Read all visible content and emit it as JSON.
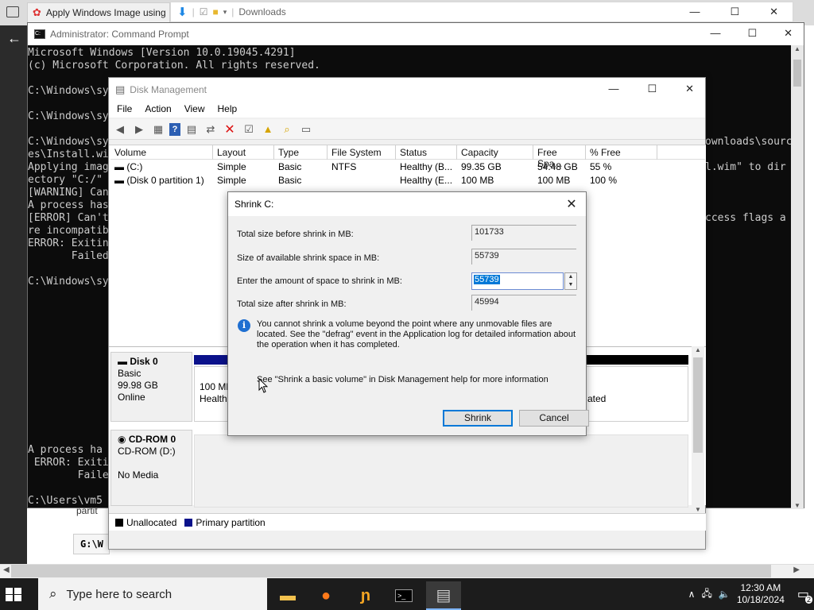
{
  "browser": {
    "tab_title": "Apply Windows Image using",
    "explorer_title": "Downloads"
  },
  "cmd": {
    "title": "Administrator: Command Prompt",
    "lines": [
      "Microsoft Windows [Version 10.0.19045.4291]",
      "(c) Microsoft Corporation. All rights reserved.",
      "",
      "C:\\Windows\\sy",
      "",
      "C:\\Windows\\sy",
      "",
      "C:\\Windows\\sy",
      "es\\Install.wi",
      "Applying imag",
      "ectory \"C:/\"",
      "[WARNING] Can",
      "A process has",
      "[ERROR] Can't",
      "re incompatib",
      "ERROR: Exitin",
      "       Failed",
      "",
      "C:\\Windows\\sy"
    ],
    "right_fragments": [
      {
        "row": 7,
        "text": "ownloads\\sourc"
      },
      {
        "row": 9,
        "text": "l.wim\" to dir"
      },
      {
        "row": 13,
        "text": "ccess flags a"
      }
    ],
    "lower_lines": [
      "A process ha",
      " ERROR: Exiti",
      "        Faile",
      "",
      "C:\\Users\\vm5",
      "",
      "C:\\Users\\vm5"
    ],
    "bg_fragments": [
      "partit",
      "G:\\W"
    ]
  },
  "disk_mgmt": {
    "title": "Disk Management",
    "menu": [
      "File",
      "Action",
      "View",
      "Help"
    ],
    "columns": [
      "Volume",
      "Layout",
      "Type",
      "File System",
      "Status",
      "Capacity",
      "Free Spa...",
      "% Free"
    ],
    "rows": [
      [
        "(C:)",
        "Simple",
        "Basic",
        "NTFS",
        "Healthy (B...",
        "99.35 GB",
        "54.48 GB",
        "55 %"
      ],
      [
        "(Disk 0 partition 1)",
        "Simple",
        "Basic",
        "",
        "Healthy (E...",
        "100 MB",
        "100 MB",
        "100 %"
      ]
    ],
    "disk0": {
      "name": "Disk 0",
      "type": "Basic",
      "size": "99.98 GB",
      "status": "Online",
      "part_size": "100 MB",
      "part_status": "Health",
      "right_fragment": "ated"
    },
    "cdrom": {
      "name": "CD-ROM 0",
      "drive": "CD-ROM (D:)",
      "status": "No Media"
    },
    "legend": [
      "Unallocated",
      "Primary partition"
    ]
  },
  "shrink": {
    "title": "Shrink C:",
    "total_before_label": "Total size before shrink in MB:",
    "total_before_value": "101733",
    "available_label": "Size of available shrink space in MB:",
    "available_value": "55739",
    "amount_label": "Enter the amount of space to shrink in MB:",
    "amount_value": "55739",
    "after_label": "Total size after shrink in MB:",
    "after_value": "45994",
    "info_text": "You cannot shrink a volume beyond the point where any unmovable files are located. See the \"defrag\" event in the Application log for detailed information about the operation when it has completed.",
    "help_text": "See \"Shrink a basic volume\" in Disk Management help for more information",
    "shrink_button": "Shrink",
    "cancel_button": "Cancel"
  },
  "taskbar": {
    "search_placeholder": "Type here to search",
    "time": "12:30 AM",
    "date": "10/18/2024",
    "notification_count": "2"
  }
}
